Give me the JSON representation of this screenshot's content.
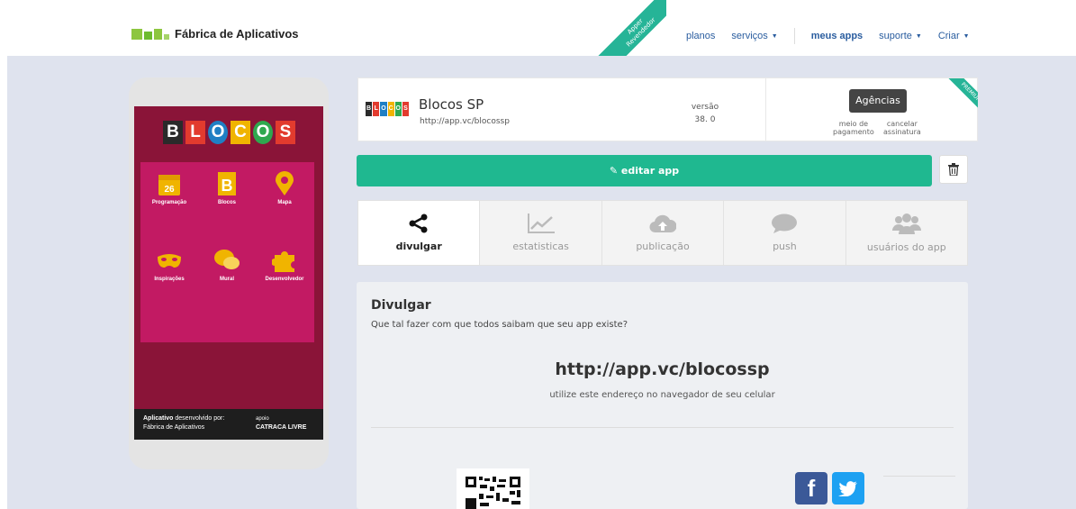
{
  "header": {
    "logo_text": "Fábrica de Aplicativos",
    "ribbon_line1": "Apper",
    "ribbon_line2": "Revendedor",
    "nav": {
      "planos": "planos",
      "servicos": "serviços",
      "meus_apps": "meus apps",
      "suporte": "suporte",
      "criar": "Criar"
    }
  },
  "phone": {
    "title_letters": [
      "B",
      "L",
      "O",
      "C",
      "O",
      "S"
    ],
    "tiles": [
      {
        "label": "Programação",
        "icon": "calendar-icon",
        "badge": "26"
      },
      {
        "label": "Blocos",
        "icon": "b-logo-icon"
      },
      {
        "label": "Mapa",
        "icon": "map-pin-icon"
      },
      {
        "label": "Inspirações",
        "icon": "mask-icon"
      },
      {
        "label": "Mural",
        "icon": "chat-bubbles-icon"
      },
      {
        "label": "Desenvolvedor",
        "icon": "puzzle-icon"
      }
    ],
    "footer_left_bold": "Aplicativo",
    "footer_left_rest": " desenvolvido por:",
    "footer_left_brand": "Fábrica de Aplicativos",
    "footer_right_small": "apoio",
    "footer_right_brand": "CATRACA LIVRE"
  },
  "app": {
    "logo_letters": [
      "B",
      "L",
      "O",
      "C",
      "O",
      "S"
    ],
    "name": "Blocos SP",
    "url": "http://app.vc/blocossp",
    "version_label": "versão",
    "version_value": "38. 0",
    "plan_button": "Agências",
    "payment_link_1": "meio de",
    "payment_link_2": "pagamento",
    "cancel_link_1": "cancelar",
    "cancel_link_2": "assinatura",
    "premium_badge": "PREMIUM"
  },
  "actions": {
    "edit_label": "editar app"
  },
  "tabs": [
    {
      "label": "divulgar",
      "icon": "share-icon",
      "active": true
    },
    {
      "label": "estatisticas",
      "icon": "line-chart-icon",
      "active": false
    },
    {
      "label": "publicação",
      "icon": "cloud-upload-icon",
      "active": false
    },
    {
      "label": "push",
      "icon": "speech-bubble-icon",
      "active": false
    },
    {
      "label": "usuários do app",
      "icon": "users-icon",
      "active": false
    }
  ],
  "panel": {
    "title": "Divulgar",
    "subtitle": "Que tal fazer com que todos saibam que seu app existe?",
    "url": "http://app.vc/blocossp",
    "hint": "utilize este endereço no navegador de seu celular"
  },
  "colors": {
    "accent_green": "#1fb890",
    "ribbon": "#26b497",
    "link_blue": "#2a5d9f",
    "page_bg": "#dfe3ee",
    "app_bg": "#8a1438",
    "card_bg": "#c21a63",
    "facebook": "#3b5998",
    "twitter": "#1da1f2"
  }
}
